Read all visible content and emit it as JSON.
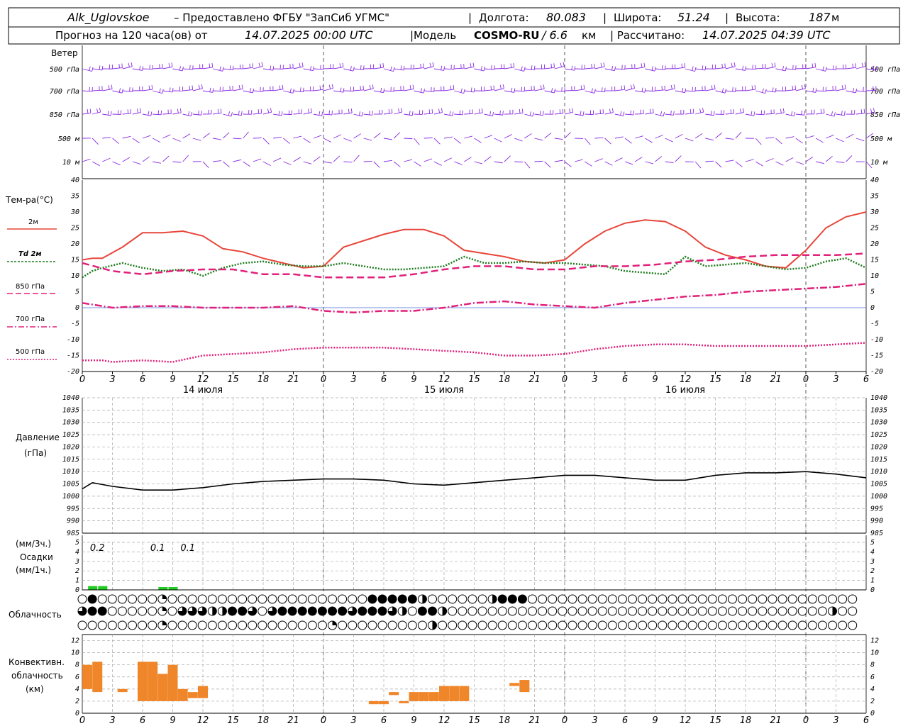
{
  "header": {
    "station": "Alk_Uglovskoe",
    "provider": "– Предоставлено ФГБУ \"ЗапСиб УГМС\"",
    "lon_label": "Долгота:",
    "lon_value": "80.083",
    "lat_label": "Широта:",
    "lat_value": "51.24",
    "alt_label": "Высота:",
    "alt_value": "187",
    "alt_unit": "м",
    "forecast_prefix": "Прогноз на 120 часа(ов) от",
    "forecast_start": "14.07.2025 00:00 UTC",
    "model_label": "|Модель",
    "model_name": "COSMO-RU",
    "model_res": "/ 6.6",
    "model_res_unit": "км",
    "calc_label": "| Рассчитано:",
    "calc_time": "14.07.2025 04:39 UTC"
  },
  "axes": {
    "x_tick_labels": [
      "0",
      "3",
      "6",
      "9",
      "12",
      "15",
      "18",
      "21",
      "0",
      "3",
      "6",
      "9",
      "12",
      "15",
      "18",
      "21",
      "0",
      "3",
      "6",
      "9",
      "12",
      "15",
      "18",
      "21",
      "0",
      "3",
      "6"
    ],
    "day_labels": [
      "14 июля",
      "15 июля",
      "16 июля"
    ]
  },
  "wind_panel": {
    "title": "Ветер",
    "levels": [
      "500 гПа",
      "700 гПа",
      "850 гПа",
      "500 м",
      "10 м"
    ],
    "colors": {
      "barb": "#8a2be2"
    }
  },
  "chart_data": [
    {
      "type": "line",
      "title": "Тем-ра(°C)",
      "ylim": [
        -20,
        40
      ],
      "yticks": [
        "40",
        "35",
        "30",
        "25",
        "20",
        "15",
        "10",
        "5",
        "0",
        "-5",
        "-10",
        "-15",
        "-20"
      ],
      "x_unit": "hours since 14.07.2025 00:00 UTC",
      "series": [
        {
          "name": "2м",
          "color": "#e8463a",
          "style": "solid",
          "x": [
            0,
            1,
            2,
            4,
            6,
            8,
            10,
            12,
            14,
            16,
            18,
            20,
            22,
            24,
            26,
            28,
            30,
            32,
            34,
            36,
            38,
            40,
            42,
            44,
            46,
            48,
            50,
            52,
            54,
            56,
            58,
            60,
            62,
            64,
            66,
            68,
            70,
            72,
            74,
            76,
            78
          ],
          "values": [
            15,
            15.5,
            15.5,
            19,
            23.5,
            23.5,
            24,
            22.5,
            18.5,
            17.5,
            15.5,
            14,
            12.5,
            13,
            19,
            21,
            23,
            24.5,
            24.5,
            22.5,
            18,
            17,
            16,
            14.5,
            14,
            15,
            20,
            24,
            26.5,
            27.5,
            27,
            24,
            19,
            16.5,
            15,
            13,
            12.5,
            18,
            25,
            28.5,
            30
          ]
        },
        {
          "name": "Td 2м",
          "color": "#1e7b1e",
          "style": "dot",
          "x": [
            0,
            1,
            2,
            4,
            6,
            8,
            10,
            12,
            14,
            16,
            18,
            20,
            22,
            24,
            26,
            28,
            30,
            32,
            34,
            36,
            38,
            40,
            42,
            44,
            46,
            48,
            50,
            52,
            54,
            56,
            58,
            60,
            62,
            64,
            66,
            68,
            70,
            72,
            74,
            76,
            78
          ],
          "values": [
            9.5,
            11.5,
            12.5,
            14,
            12.5,
            11.5,
            12,
            10,
            12.5,
            14,
            14.5,
            13.5,
            13,
            13,
            14,
            13,
            12,
            12,
            12.5,
            13,
            16,
            14,
            14,
            14.5,
            14,
            14,
            13.5,
            13,
            11.5,
            11,
            10.5,
            16,
            13,
            13.5,
            14,
            13,
            12,
            12.5,
            14.5,
            15.5,
            12.5
          ]
        },
        {
          "name": "850 гПа",
          "color": "#e0207a",
          "style": "dash",
          "x": [
            0,
            3,
            6,
            9,
            12,
            15,
            18,
            21,
            24,
            27,
            30,
            33,
            36,
            39,
            42,
            45,
            48,
            51,
            54,
            57,
            60,
            63,
            66,
            69,
            72,
            75,
            78
          ],
          "values": [
            14,
            11.5,
            10.5,
            11.5,
            12,
            12,
            10.5,
            10.5,
            9.5,
            9.5,
            9.5,
            10.5,
            12,
            13,
            13,
            12,
            12,
            13,
            13,
            13.5,
            14.5,
            15,
            16,
            16.5,
            16.5,
            16.5,
            17
          ]
        },
        {
          "name": "700 гПа",
          "color": "#e0207a",
          "style": "dashdot",
          "x": [
            0,
            3,
            6,
            9,
            12,
            15,
            18,
            21,
            24,
            27,
            30,
            33,
            36,
            39,
            42,
            45,
            48,
            51,
            54,
            57,
            60,
            63,
            66,
            69,
            72,
            75,
            78
          ],
          "values": [
            1.5,
            0,
            0.5,
            0.5,
            0,
            0,
            0,
            0.5,
            -1,
            -1.5,
            -1,
            -1,
            0,
            1.5,
            2,
            1,
            0.5,
            0,
            1.5,
            2.5,
            3.5,
            4,
            5,
            5.5,
            6,
            6.5,
            7.5
          ]
        },
        {
          "name": "500 гПа",
          "color": "#e0207a",
          "style": "dot",
          "x": [
            0,
            2,
            3,
            6,
            9,
            12,
            15,
            18,
            21,
            24,
            27,
            30,
            33,
            36,
            39,
            42,
            45,
            48,
            51,
            54,
            57,
            60,
            63,
            66,
            69,
            72,
            75,
            78
          ],
          "values": [
            -16.5,
            -16.5,
            -17,
            -16.5,
            -17,
            -15,
            -14.5,
            -14,
            -13,
            -12.5,
            -12.5,
            -12.5,
            -13,
            -13.5,
            -14,
            -15,
            -15,
            -14.5,
            -13,
            -12,
            -11.5,
            -11.5,
            -12,
            -12,
            -12,
            -12,
            -11.5,
            -11
          ]
        }
      ]
    },
    {
      "type": "line",
      "title": "Давление",
      "ylabel": "(гПа)",
      "ylim": [
        985,
        1040
      ],
      "yticks": [
        "1040",
        "1035",
        "1030",
        "1025",
        "1020",
        "1015",
        "1010",
        "1005",
        "1000",
        "995",
        "990",
        "985"
      ],
      "series": [
        {
          "name": "",
          "color": "#000000",
          "style": "solid",
          "x": [
            0,
            1,
            3,
            6,
            9,
            12,
            15,
            18,
            21,
            24,
            27,
            30,
            33,
            36,
            39,
            42,
            45,
            48,
            51,
            54,
            57,
            60,
            63,
            66,
            69,
            72,
            75,
            78
          ],
          "values": [
            1003,
            1005.5,
            1004,
            1002.5,
            1002.5,
            1003.5,
            1005,
            1006,
            1006.5,
            1007,
            1007,
            1006.5,
            1005,
            1004.5,
            1005.5,
            1006.5,
            1007.5,
            1008.5,
            1008.5,
            1007.5,
            1006.5,
            1006.5,
            1008.5,
            1009.5,
            1009.5,
            1010,
            1009,
            1007.5
          ]
        }
      ]
    },
    {
      "type": "bar",
      "title": "Осадки",
      "ylabel_top": "(мм/3ч.)",
      "ylabel_bottom": "(мм/1ч.)",
      "ylim": [
        0,
        5
      ],
      "yticks": [
        "5",
        "4",
        "3",
        "2",
        "1",
        "0"
      ],
      "color": "#22cc22",
      "x": [
        1,
        2,
        8,
        9
      ],
      "values": [
        0.2,
        0.2,
        0.1,
        0.1
      ],
      "annotations": [
        {
          "x": 1.5,
          "text": "0.2"
        },
        {
          "x": 7.5,
          "text": "0.1"
        },
        {
          "x": 10.5,
          "text": "0.1"
        }
      ]
    },
    {
      "type": "bar",
      "title": "Конвективн.",
      "ylabel": "облачность",
      "unit": "(км)",
      "ylim": [
        0,
        13
      ],
      "yticks": [
        "12",
        "10",
        "8",
        "6",
        "4",
        "2",
        "0"
      ],
      "color": "#f0862a",
      "bars": [
        {
          "x": 0.5,
          "base": 4,
          "top": 8
        },
        {
          "x": 1.5,
          "base": 3.5,
          "top": 8.5
        },
        {
          "x": 4,
          "base": 3.5,
          "top": 4
        },
        {
          "x": 6,
          "base": 2,
          "top": 8.5
        },
        {
          "x": 7,
          "base": 2,
          "top": 8.5
        },
        {
          "x": 8,
          "base": 2,
          "top": 6.5
        },
        {
          "x": 9,
          "base": 2,
          "top": 8
        },
        {
          "x": 10,
          "base": 2,
          "top": 4
        },
        {
          "x": 11,
          "base": 2.5,
          "top": 3.5
        },
        {
          "x": 12,
          "base": 2.5,
          "top": 4.5
        },
        {
          "x": 29,
          "base": 1.5,
          "top": 2
        },
        {
          "x": 30,
          "base": 1.5,
          "top": 2
        },
        {
          "x": 31,
          "base": 3,
          "top": 3.5
        },
        {
          "x": 32,
          "base": 2,
          "top": 2
        },
        {
          "x": 33,
          "base": 2,
          "top": 3.5
        },
        {
          "x": 34,
          "base": 2,
          "top": 3.5
        },
        {
          "x": 35,
          "base": 2,
          "top": 3.5
        },
        {
          "x": 36,
          "base": 2,
          "top": 4.5
        },
        {
          "x": 37,
          "base": 2,
          "top": 4.5
        },
        {
          "x": 38,
          "base": 2,
          "top": 4.5
        },
        {
          "x": 43,
          "base": 4.5,
          "top": 5
        },
        {
          "x": 44,
          "base": 3.5,
          "top": 5.5
        }
      ]
    }
  ],
  "cloud_panel": {
    "title": "Облачность",
    "rows": [
      "oFMoooooRooooooooooooooooooooFFFFFHooooooHFFFooooooooooooooooooooooooooooooooo",
      "QFFoooooRoQQQHHFFQoQFFFFFFFQFFFQHoFFHooooooooooooooooooooooooooooooooooooooHoo",
      "ooooooooRooooooooooooooooRoooooooooHoooooooooooooooooooooooooooooooooooooooooo"
    ]
  }
}
